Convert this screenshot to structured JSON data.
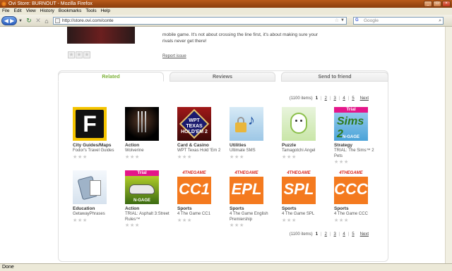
{
  "window": {
    "title": "Ovi Store: BURNOUT - Mozilla Firefox"
  },
  "menu": [
    "File",
    "Edit",
    "View",
    "History",
    "Bookmarks",
    "Tools",
    "Help"
  ],
  "nav": {
    "url": "http://store.ovi.com/conte",
    "search_placeholder": "Google",
    "search_engine": "G"
  },
  "hero": {
    "description": "mobile game. It's not about crossing the line first, it's about making sure your rivals never get there!",
    "report_link": "Report issue"
  },
  "tabs": [
    {
      "label": "Related",
      "active": true
    },
    {
      "label": "Reviews",
      "active": false
    },
    {
      "label": "Send to friend",
      "active": false
    }
  ],
  "pager": {
    "total": "(1100 items)",
    "pages": [
      "1",
      "2",
      "3",
      "4",
      "5"
    ],
    "current": "1",
    "next": "Next"
  },
  "apps": [
    {
      "category": "City Guides/Maps",
      "name": "Fodor's Travel Guides",
      "icon": "fodor-icon"
    },
    {
      "category": "Action",
      "name": "Wolverine",
      "icon": "wolverine-icon"
    },
    {
      "category": "Card & Casino",
      "name": "WPT Texas Hold 'Em 2",
      "icon": "wpt-icon",
      "art": "WPT\nTEXAS\nHOLD'EM 2"
    },
    {
      "category": "Utilities",
      "name": "Ultimate SMS",
      "icon": "sms-icon"
    },
    {
      "category": "Puzzle",
      "name": "Tamagotchi Angel",
      "icon": "tamagotchi-icon"
    },
    {
      "category": "Strategy",
      "name": "TRIAL: The Sims™ 2 Pets",
      "icon": "sims-icon",
      "badge": "Trial",
      "art": "Sims 2",
      "platform": "N-GAGE"
    },
    {
      "category": "Education",
      "name": "GetawayPhrases",
      "icon": "phrases-icon"
    },
    {
      "category": "Action",
      "name": "TRIAL: Asphalt 3:Street Rules™",
      "icon": "asphalt-icon",
      "badge": "Trial",
      "platform": "N-GAGE"
    },
    {
      "category": "Sports",
      "name": "4 The Game CC1",
      "icon": "cc1-icon",
      "brand": "4THEGAME",
      "art": "CC1"
    },
    {
      "category": "Sports",
      "name": "4 The Game English Premiership",
      "icon": "epl-icon",
      "brand": "4THEGAME",
      "art": "EPL"
    },
    {
      "category": "Sports",
      "name": "4 The Game SPL",
      "icon": "spl-icon",
      "brand": "4THEGAME",
      "art": "SPL"
    },
    {
      "category": "Sports",
      "name": "4 The Game CCC",
      "icon": "ccc-icon",
      "brand": "4THEGAME",
      "art": "CCC"
    }
  ],
  "status": "Done",
  "colors": {
    "accent_tab": "#7db239",
    "trial_badge": "#e4168a",
    "titlebar": "#a04b14",
    "tgame_orange": "#f47a1f"
  }
}
